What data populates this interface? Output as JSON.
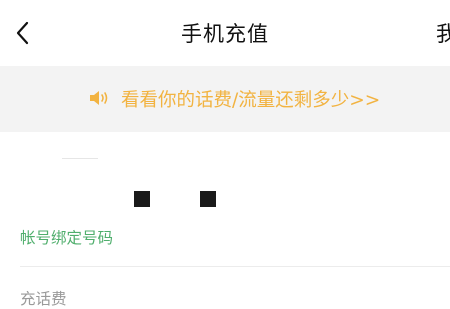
{
  "header": {
    "title": "手机充值",
    "right_action_partial": "我",
    "back_icon": "chevron-left-icon"
  },
  "notice": {
    "icon": "speaker-icon",
    "text": "看看你的话费/流量还剩多少>>",
    "color": "#f2b341"
  },
  "account": {
    "bound_label": "帐号绑定号码",
    "bound_label_color": "#4fae6c",
    "category_partial": "充话费"
  }
}
